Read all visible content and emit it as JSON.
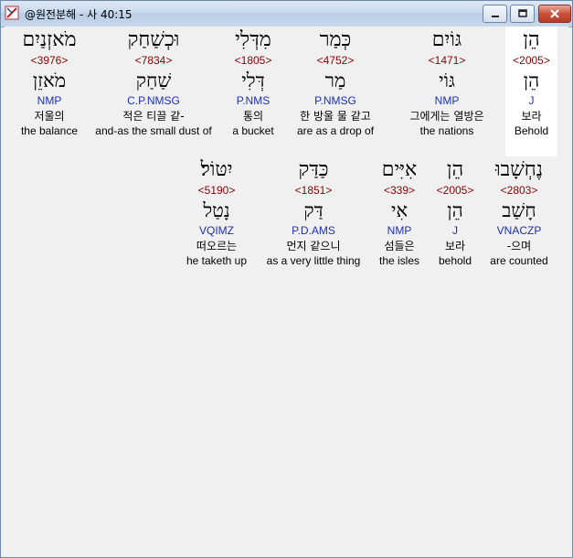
{
  "window": {
    "title": "@원전분해 - 사 40:15",
    "buttons": {
      "minimize": "minimize",
      "maximize": "maximize",
      "close": "close"
    }
  },
  "line1": [
    {
      "heb": "הֵן",
      "strong": "<2005>",
      "lemma": "הֵן",
      "morph": "J",
      "kor": "보라",
      "eng": "Behold"
    },
    {
      "heb": "גּוֹיִם",
      "strong": "<1471>",
      "lemma": "גּוֹי",
      "morph": "NMP",
      "kor": "그에게는 열방은",
      "eng": "the nations"
    },
    {
      "heb": "כְּמַר",
      "strong": "<4752>",
      "lemma": "מַר",
      "morph": "P.NMSG",
      "kor": "한 방울 물 같고",
      "eng": "are as a drop of"
    },
    {
      "heb": "מִדְּלִי",
      "strong": "<1805>",
      "lemma": "דְּלִי",
      "morph": "P.NMS",
      "kor": "통의",
      "eng": "a bucket"
    },
    {
      "heb": "וּכְשַׁחַק",
      "strong": "<7834>",
      "lemma": "שַׁחַק",
      "morph": "C.P.NMSG",
      "kor": "적은 티끌 같-",
      "eng": "and-as the small dust of"
    },
    {
      "heb": "מֹאזְנַיִם",
      "strong": "<3976>",
      "lemma": "מֹאזֵן",
      "morph": "NMP",
      "kor": "저울의",
      "eng": "the balance"
    }
  ],
  "line2": [
    {
      "heb": "נֶחְשָׁבוּ",
      "strong": "<2803>",
      "lemma": "חָשַׁב",
      "morph": "VNACZP",
      "kor": "-으며",
      "eng": "are counted"
    },
    {
      "heb": "הֵן",
      "strong": "<2005>",
      "lemma": "הֵן",
      "morph": "J",
      "kor": "보라",
      "eng": "behold"
    },
    {
      "heb": "אִיִּים",
      "strong": "<339>",
      "lemma": "אִי",
      "morph": "NMP",
      "kor": "섬들은",
      "eng": "the isles"
    },
    {
      "heb": "כַּדַּק",
      "strong": "<1851>",
      "lemma": "דַּק",
      "morph": "P.D.AMS",
      "kor": "먼지 같으니",
      "eng": "as a very little thing"
    },
    {
      "heb": "יִטּוֹל׃",
      "strong": "<5190>",
      "lemma": "נָטַל",
      "morph": "VQIMZ",
      "kor": "떠오르는",
      "eng": "he taketh up"
    }
  ]
}
